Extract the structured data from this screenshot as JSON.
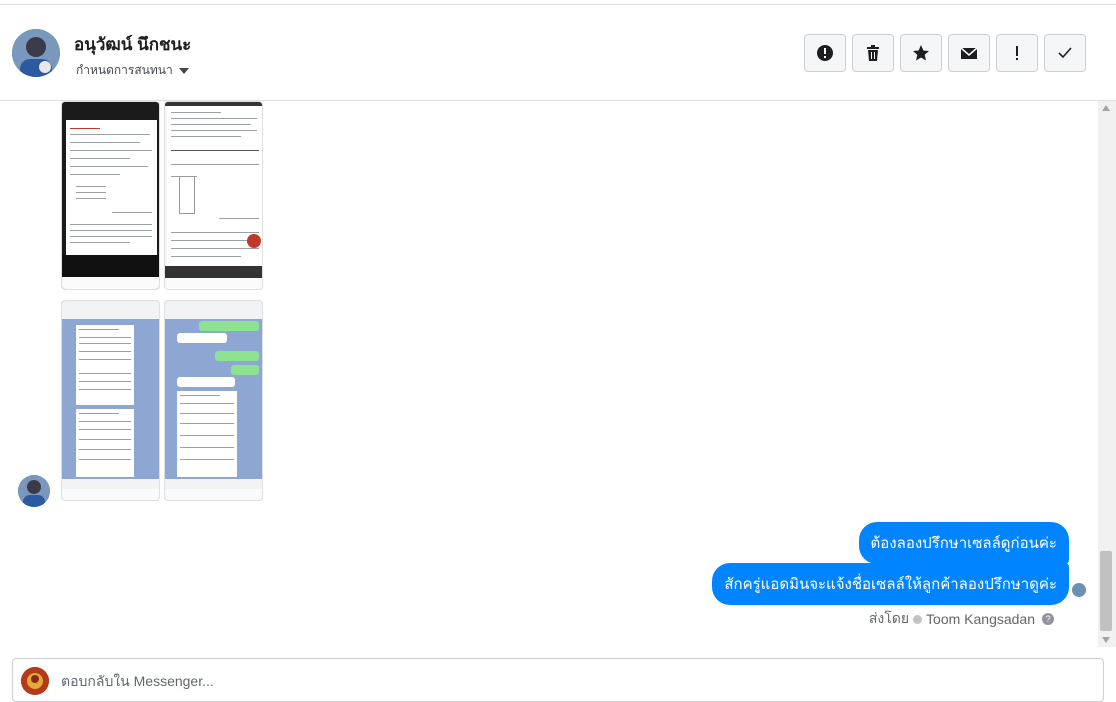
{
  "header": {
    "contact_name": "อนุวัฒน์ นึกชนะ",
    "conversation_settings_label": "กำหนดการสนทนา",
    "actions": [
      {
        "name": "spam-button",
        "icon": "exclamation-circle-icon"
      },
      {
        "name": "delete-button",
        "icon": "trash-icon"
      },
      {
        "name": "star-button",
        "icon": "star-icon"
      },
      {
        "name": "mark-unread-button",
        "icon": "envelope-icon"
      },
      {
        "name": "follow-up-button",
        "icon": "exclamation-icon"
      },
      {
        "name": "mark-done-button",
        "icon": "check-icon"
      }
    ]
  },
  "thread": {
    "outgoing_messages": [
      "ต้องลองปรึกษาเซลล์ดูก่อนค่ะ",
      "สักครู่แอดมินจะแจ้งชื่อเซลล์ให้ลูกค้าลองปรึกษาดูค่ะ"
    ],
    "sent_by_prefix": "ส่งโดย",
    "sent_by_name": "Toom Kangsadan"
  },
  "reply": {
    "placeholder": "ตอบกลับใน Messenger..."
  },
  "colors": {
    "bubble": "#0084ff",
    "border": "#dddfe2"
  }
}
